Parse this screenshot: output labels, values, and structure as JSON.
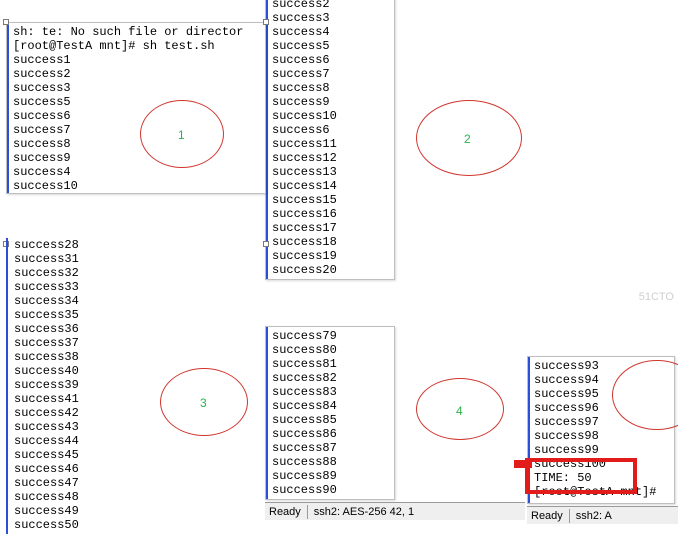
{
  "panel1": {
    "error_line": "sh: te: No such file or director",
    "prompt_line": "[root@TestA mnt]# sh test.sh",
    "lines": [
      "success1",
      "success2",
      "success3",
      "success5",
      "success6",
      "success7",
      "success8",
      "success9",
      "success4",
      "success10"
    ]
  },
  "panel2": {
    "lines": [
      "success2",
      "success3",
      "success4",
      "success5",
      "success6",
      "success7",
      "success8",
      "success9",
      "success10",
      "success6",
      "success11",
      "success12",
      "success13",
      "success14",
      "success15",
      "success16",
      "success17",
      "success18",
      "success19",
      "success20"
    ]
  },
  "panel3": {
    "lines": [
      "success28",
      "success31",
      "success32",
      "success33",
      "success34",
      "success35",
      "success36",
      "success37",
      "success38",
      "success40",
      "success39",
      "success41",
      "success42",
      "success43",
      "success44",
      "success45",
      "success46",
      "success47",
      "success48",
      "success49",
      "success50"
    ]
  },
  "panel4": {
    "lines": [
      "success79",
      "success80",
      "success81",
      "success82",
      "success83",
      "success84",
      "success85",
      "success86",
      "success87",
      "success88",
      "success89",
      "success90"
    ]
  },
  "panel5": {
    "lines": [
      "success93",
      "success94",
      "success95",
      "success96",
      "success97",
      "success98",
      "success99",
      "",
      "success100",
      "TIME: 50"
    ],
    "prompt_tail": "[root@TestA mnt]#"
  },
  "labels": {
    "n1": "1",
    "n2": "2",
    "n3": "3",
    "n4": "4"
  },
  "status": {
    "left": "Ready",
    "mid": "ssh2: AES-256  42,  1",
    "right_ready": "Ready",
    "right_ssh": "ssh2: A"
  },
  "watermark": "51CTO"
}
